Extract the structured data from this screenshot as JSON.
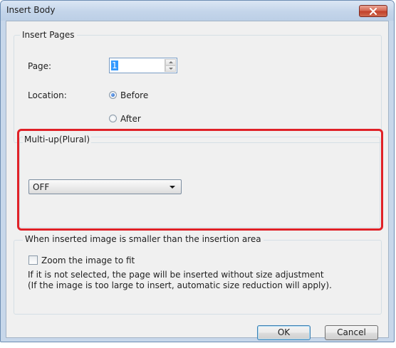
{
  "window": {
    "title": "Insert Body"
  },
  "insert_pages": {
    "legend": "Insert Pages",
    "page_label": "Page:",
    "page_value": "1",
    "location_label": "Location:",
    "before_label": "Before",
    "after_label": "After",
    "selected_location": "Before"
  },
  "multi_up": {
    "legend": "Multi-up(Plural)",
    "selected_value": "OFF",
    "highlight_color": "#e02127"
  },
  "smaller_image": {
    "legend": "When inserted image is smaller than the insertion area",
    "zoom_label": "Zoom the image to fit",
    "zoom_checked": false,
    "note_line1": "If it is not selected, the page will be inserted without size adjustment",
    "note_line2": "(If the image is too large to insert, automatic size reduction will apply)."
  },
  "buttons": {
    "ok": "OK",
    "cancel": "Cancel"
  },
  "icons": {
    "close": "close-icon",
    "dropdown": "chevron-down-icon"
  }
}
